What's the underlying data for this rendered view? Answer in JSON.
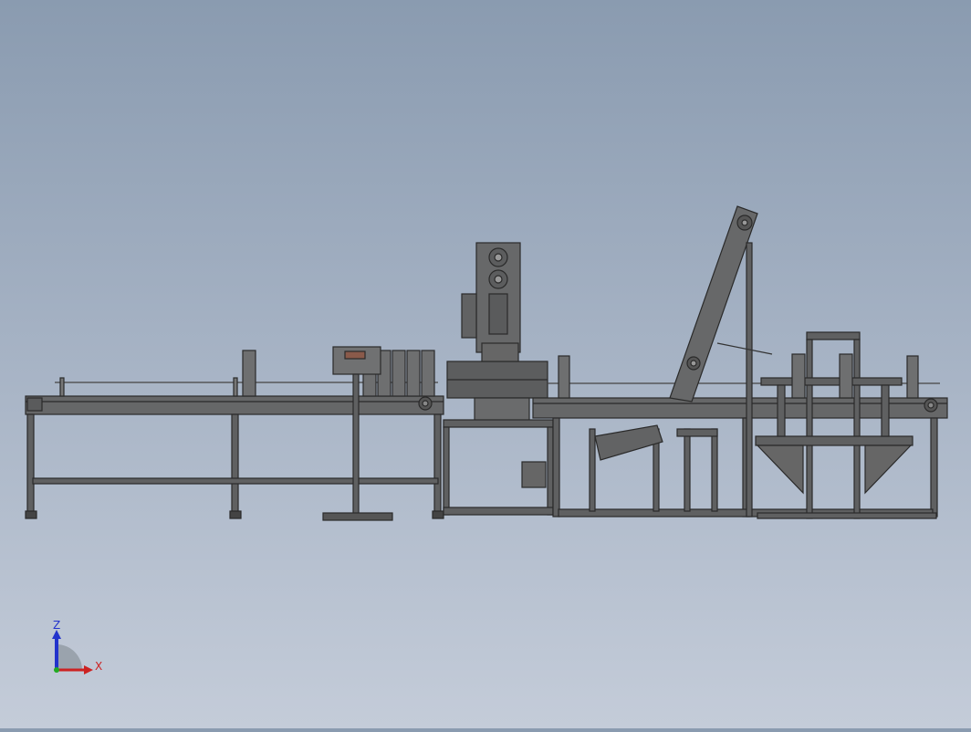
{
  "viewport": {
    "background_top": "#8a9bb0",
    "background_bottom": "#c4ccd9",
    "model_color": "#5f6061",
    "model_edge": "#2a2a2a"
  },
  "triad": {
    "z_label": "Z",
    "x_label": "X",
    "z_color": "#2233cc",
    "x_color": "#cc2222",
    "y_color": "#22aa22"
  }
}
